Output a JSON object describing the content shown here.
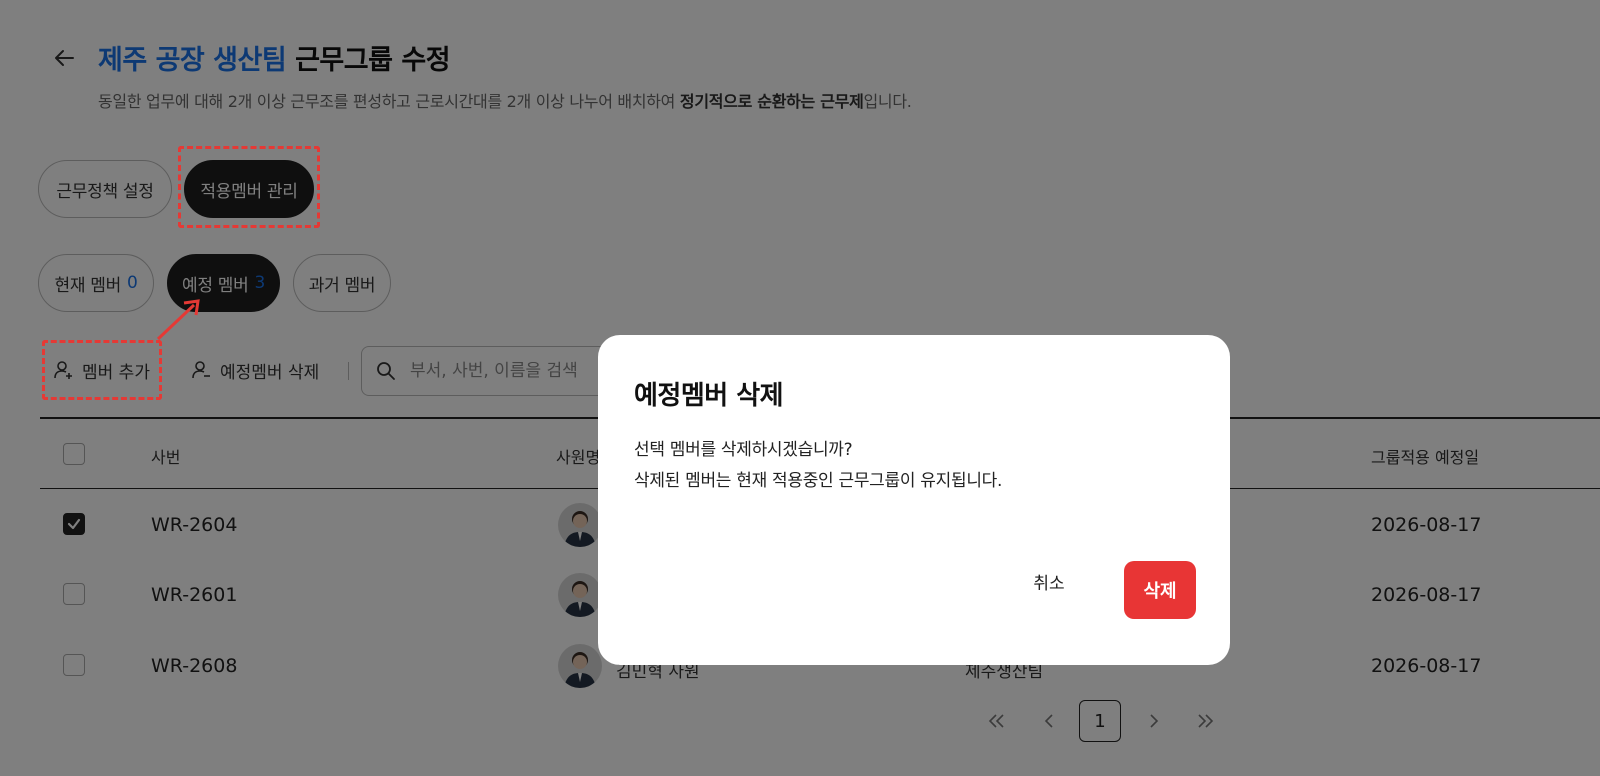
{
  "header": {
    "title_highlight": "제주 공장 생산팀",
    "title_rest": "근무그룹 수정",
    "subtitle_pre": "동일한 업무에 대해 2개 이상 근무조를 편성하고 근로시간대를 2개 이상 나누어 배치하여 ",
    "subtitle_bold": "정기적으로 순환하는 근무제",
    "subtitle_post": "입니다."
  },
  "main_tabs": [
    {
      "label": "근무정책 설정",
      "active": false
    },
    {
      "label": "적용멤버 관리",
      "active": true
    }
  ],
  "member_tabs": [
    {
      "label": "현재 멤버",
      "count": "0",
      "active": false
    },
    {
      "label": "예정 멤버",
      "count": "3",
      "active": true
    },
    {
      "label": "과거 멤버",
      "count": "",
      "active": false
    }
  ],
  "toolbar": {
    "add_label": "멤버 추가",
    "delete_label": "예정멤버 삭제",
    "search_placeholder": "부서, 사번, 이름을 검색"
  },
  "table": {
    "columns": [
      "사번",
      "사원명",
      "그룹적용 예정일"
    ],
    "rows": [
      {
        "id": "WR-2604",
        "name": "",
        "dept": "",
        "date": "2026-08-17",
        "checked": true
      },
      {
        "id": "WR-2601",
        "name": "",
        "dept": "",
        "date": "2026-08-17",
        "checked": false
      },
      {
        "id": "WR-2608",
        "name": "김민혁 사원",
        "dept": "제주생산팀",
        "date": "2026-08-17",
        "checked": false
      }
    ]
  },
  "pagination": {
    "current": "1",
    "icons": [
      "first-page-icon",
      "prev-page-icon",
      "next-page-icon",
      "last-page-icon"
    ]
  },
  "modal": {
    "title": "예정멤버 삭제",
    "line1": "선택 멤버를 삭제하시겠습니까?",
    "line2": "삭제된 멤버는 현재 적용중인 근무그룹이 유지됩니다.",
    "cancel_label": "취소",
    "confirm_label": "삭제"
  },
  "colors": {
    "accent": "#1a73e8",
    "danger": "#e83535",
    "annotation": "#e53935",
    "dark": "#1f1f1f"
  }
}
